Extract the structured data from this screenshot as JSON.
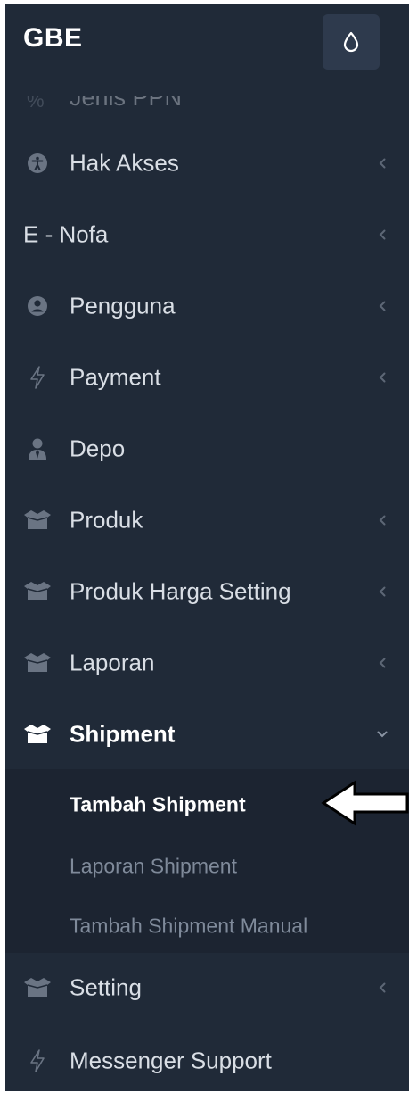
{
  "brand": {
    "title": "GBE",
    "theme_toggle_icon": "droplet-icon"
  },
  "cut_item": {
    "label": "Jenis PPN",
    "icon": "percent-icon"
  },
  "menu": {
    "items": [
      {
        "label": "Hak Akses",
        "icon": "accessibility-icon",
        "has_chevron": true
      },
      {
        "label": "E - Nofa",
        "icon": "",
        "has_chevron": true
      },
      {
        "label": "Pengguna",
        "icon": "user-circle-icon",
        "has_chevron": true
      },
      {
        "label": "Payment",
        "icon": "bolt-icon",
        "has_chevron": true
      },
      {
        "label": "Depo",
        "icon": "user-tie-icon",
        "has_chevron": false
      },
      {
        "label": "Produk",
        "icon": "box-open-icon",
        "has_chevron": true
      },
      {
        "label": "Produk Harga Setting",
        "icon": "box-open-icon",
        "has_chevron": true
      },
      {
        "label": "Laporan",
        "icon": "box-open-icon",
        "has_chevron": true
      },
      {
        "label": "Shipment",
        "icon": "box-open-icon",
        "has_chevron": true,
        "expanded": true
      },
      {
        "label": "Setting",
        "icon": "box-open-icon",
        "has_chevron": true
      },
      {
        "label": "Messenger Support",
        "icon": "bolt-icon",
        "has_chevron": false
      }
    ],
    "shipment_submenu": [
      {
        "label": "Tambah Shipment",
        "active": true
      },
      {
        "label": "Laporan Shipment",
        "active": false
      },
      {
        "label": "Tambah Shipment Manual",
        "active": false
      }
    ]
  },
  "colors": {
    "sidebar_bg": "#202a38",
    "submenu_bg": "#1c2431",
    "text": "#d9dee5",
    "muted_text": "#7f8a9a",
    "icon": "#6a7483",
    "active": "#ffffff"
  },
  "annotation": {
    "icon": "left-arrow-icon"
  }
}
